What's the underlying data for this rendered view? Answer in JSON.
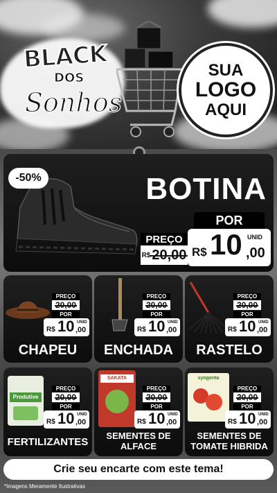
{
  "header": {
    "brand_line1": "BLACK",
    "brand_line2": "DOS",
    "brand_line3": "Sonhos",
    "logo_placeholder": [
      "SUA",
      "LOGO",
      "AQUI"
    ]
  },
  "featured": {
    "discount": "-50%",
    "name": "BOTINA",
    "preco_label": "PREÇO",
    "old_price": "20,00",
    "old_prefix": "R$",
    "por_label": "POR",
    "currency": "R$",
    "new_price_int": "10",
    "new_price_cents": ",00",
    "unit": "UNID"
  },
  "products": [
    {
      "name": "CHAPEU",
      "old": "20,00",
      "int": "10",
      "cents": ",00"
    },
    {
      "name": "ENCHADA",
      "old": "20,00",
      "int": "10",
      "cents": ",00"
    },
    {
      "name": "RASTELO",
      "old": "20,00",
      "int": "10",
      "cents": ",00"
    },
    {
      "name": "FERTILIZANTES",
      "old": "20,00",
      "int": "10",
      "cents": ",00"
    },
    {
      "name": "SEMENTES DE ALFACE",
      "old": "20,00",
      "int": "10",
      "cents": ",00"
    },
    {
      "name": "SEMENTES DE TOMATE HIBRIDA",
      "old": "20,00",
      "int": "10",
      "cents": ",00"
    }
  ],
  "labels": {
    "preco": "PREÇO",
    "por": "POR",
    "currency": "R$",
    "unit": "UNID"
  },
  "package_text": {
    "fertilizer": "Produtive",
    "alface_brand": "SAKATA",
    "tomato_brand": "syngenta"
  },
  "cta": "Crie seu encarte com este tema!",
  "disclaimer": "*Imagens Meramente Ilustrativas",
  "colors": {
    "accent": "#000000",
    "panel": "#141414",
    "price_bg": "#ffffff"
  }
}
